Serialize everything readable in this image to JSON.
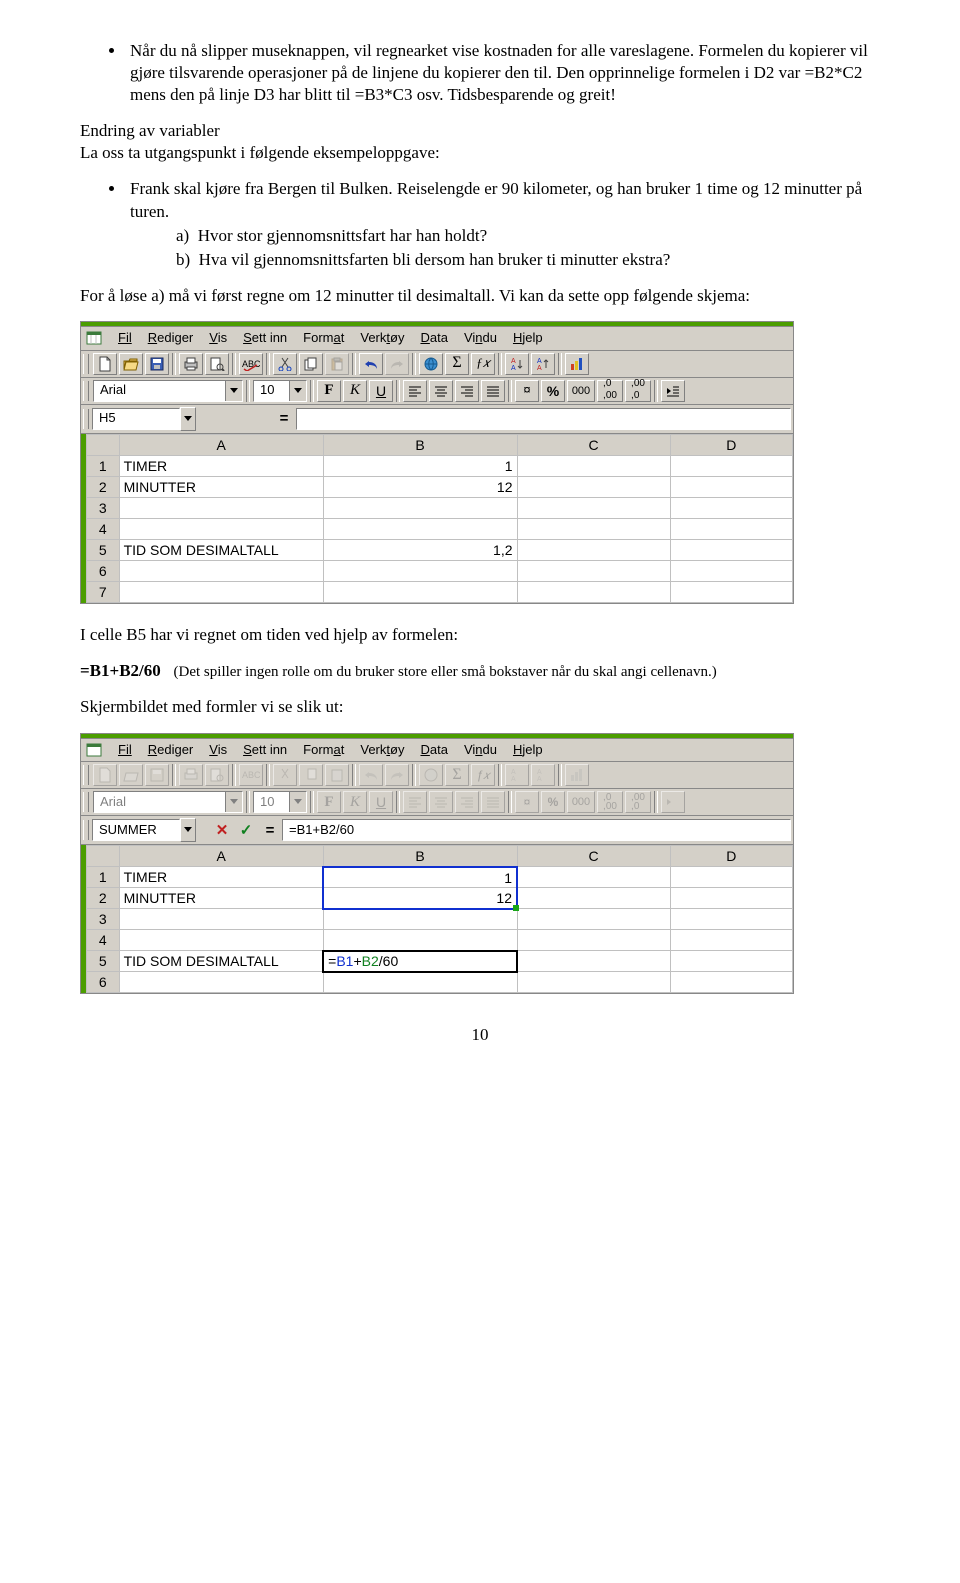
{
  "doc": {
    "bullet1": "Når du nå slipper museknappen, vil regnearket vise kostnaden for alle vareslagene. Formelen du kopierer vil gjøre tilsvarende operasjoner på de linjene du kopierer den til. Den opprinnelige formelen i D2 var =B2*C2 mens den på linje D3 har blitt til =B3*C3 osv. Tidsbesparende og greit!",
    "sub_heading": "Endring av variabler",
    "sub_line": "La oss ta utgangspunkt i følgende eksempeloppgave:",
    "bullet2": "Frank skal kjøre fra Bergen til Bulken. Reiselengde er 90 kilometer, og han bruker 1 time og 12 minutter på turen.",
    "letter_a_label": "a)",
    "letter_a": "Hvor stor gjennomsnittsfart har han holdt?",
    "letter_b_label": "b)",
    "letter_b": "Hva vil gjennomsnittsfarten bli dersom han bruker ti minutter ekstra?",
    "para1": "For å løse a) må vi først regne om 12 minutter til desimaltall. Vi kan da sette opp følgende skjema:",
    "para2": "I celle B5 har vi regnet om tiden ved hjelp av formelen:",
    "formula": "=B1+B2/60",
    "formula_note": "(Det spiller ingen rolle om du bruker store eller små bokstaver når du skal angi cellenavn.)",
    "para3": "Skjermbildet med formler vi se slik ut:",
    "page_num": "10"
  },
  "menu": {
    "fil": "Fil",
    "rediger": "Rediger",
    "vis": "Vis",
    "settinn": "Sett inn",
    "format": "Format",
    "verktoy": "Verktøy",
    "data": "Data",
    "vindu": "Vindu",
    "hjelp": "Hjelp"
  },
  "format": {
    "font": "Arial",
    "size": "10",
    "bold": "F",
    "italic": "K",
    "underline": "U",
    "currency": "%",
    "thousand": "000",
    "inc": ",00",
    "inc_small": "0",
    "dec": ",00",
    "dec_small": "0"
  },
  "ref1": {
    "cell": "H5",
    "formula": ""
  },
  "ref2": {
    "cell": "SUMMER",
    "formula": "=B1+B2/60"
  },
  "sheet": {
    "colA": "A",
    "colB": "B",
    "colC": "C",
    "colD": "D",
    "r1": "1",
    "r2": "2",
    "r3": "3",
    "r4": "4",
    "r5": "5",
    "r6": "6",
    "r7": "7",
    "a1": "TIMER",
    "b1": "1",
    "a2": "MINUTTER",
    "b2": "12",
    "a5": "TID SOM DESIMALTALL",
    "b5a": "1,2",
    "b5b": "=B1+B2/60"
  },
  "icons": {
    "sigma": "Σ",
    "fx": "ƒ𝑥",
    "equals": "=",
    "cancel": "✕",
    "accept": "✓",
    "curr": "¤"
  }
}
